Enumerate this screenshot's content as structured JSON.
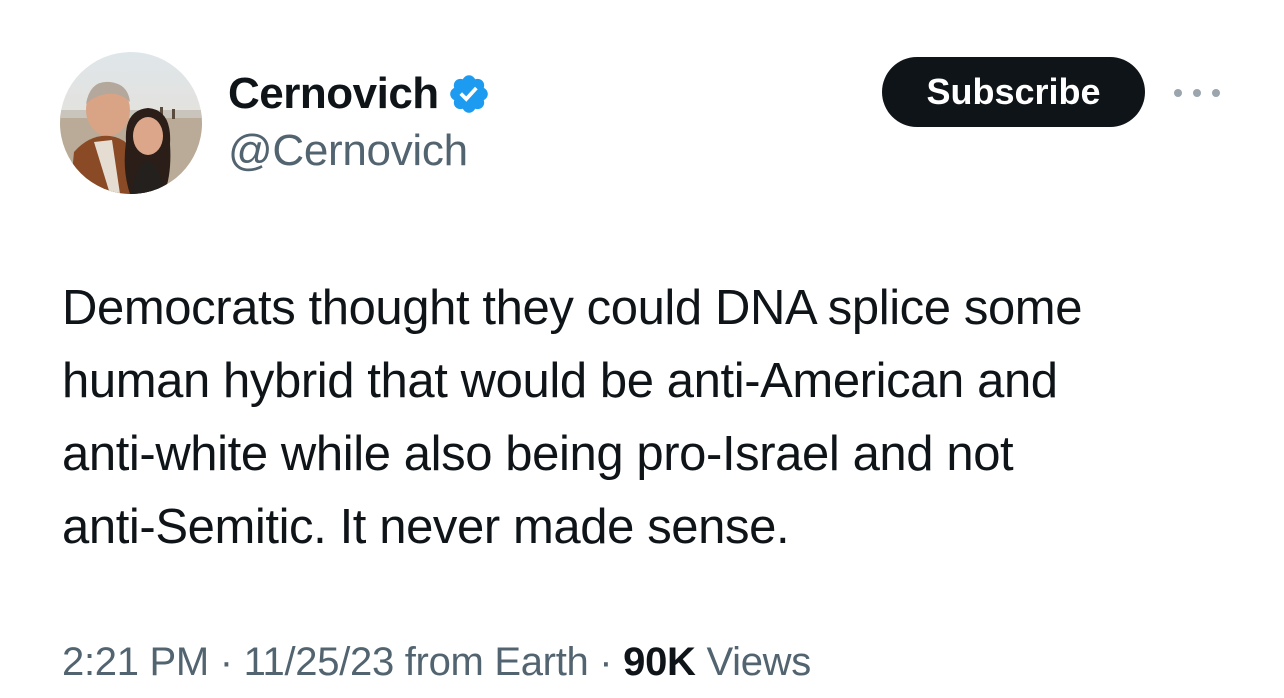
{
  "author": {
    "display_name": "Cernovich",
    "handle": "@Cernovich",
    "verified_icon": "verified-badge-icon",
    "verified_color": "#1d9bf0"
  },
  "actions": {
    "subscribe_label": "Subscribe",
    "more_icon": "more-options-icon"
  },
  "tweet": {
    "text": "Democrats thought they could DNA splice some\nhuman hybrid that would be anti-American and\nanti-white while also being pro-Israel and not\nanti-Semitic. It never made sense."
  },
  "meta": {
    "time": "2:21 PM",
    "separator": "·",
    "date": "11/25/23",
    "source": "from Earth",
    "views_count": "90K",
    "views_label": "Views"
  },
  "colors": {
    "text_primary": "#0f1419",
    "text_secondary": "#536471",
    "button_bg": "#0f1419"
  }
}
